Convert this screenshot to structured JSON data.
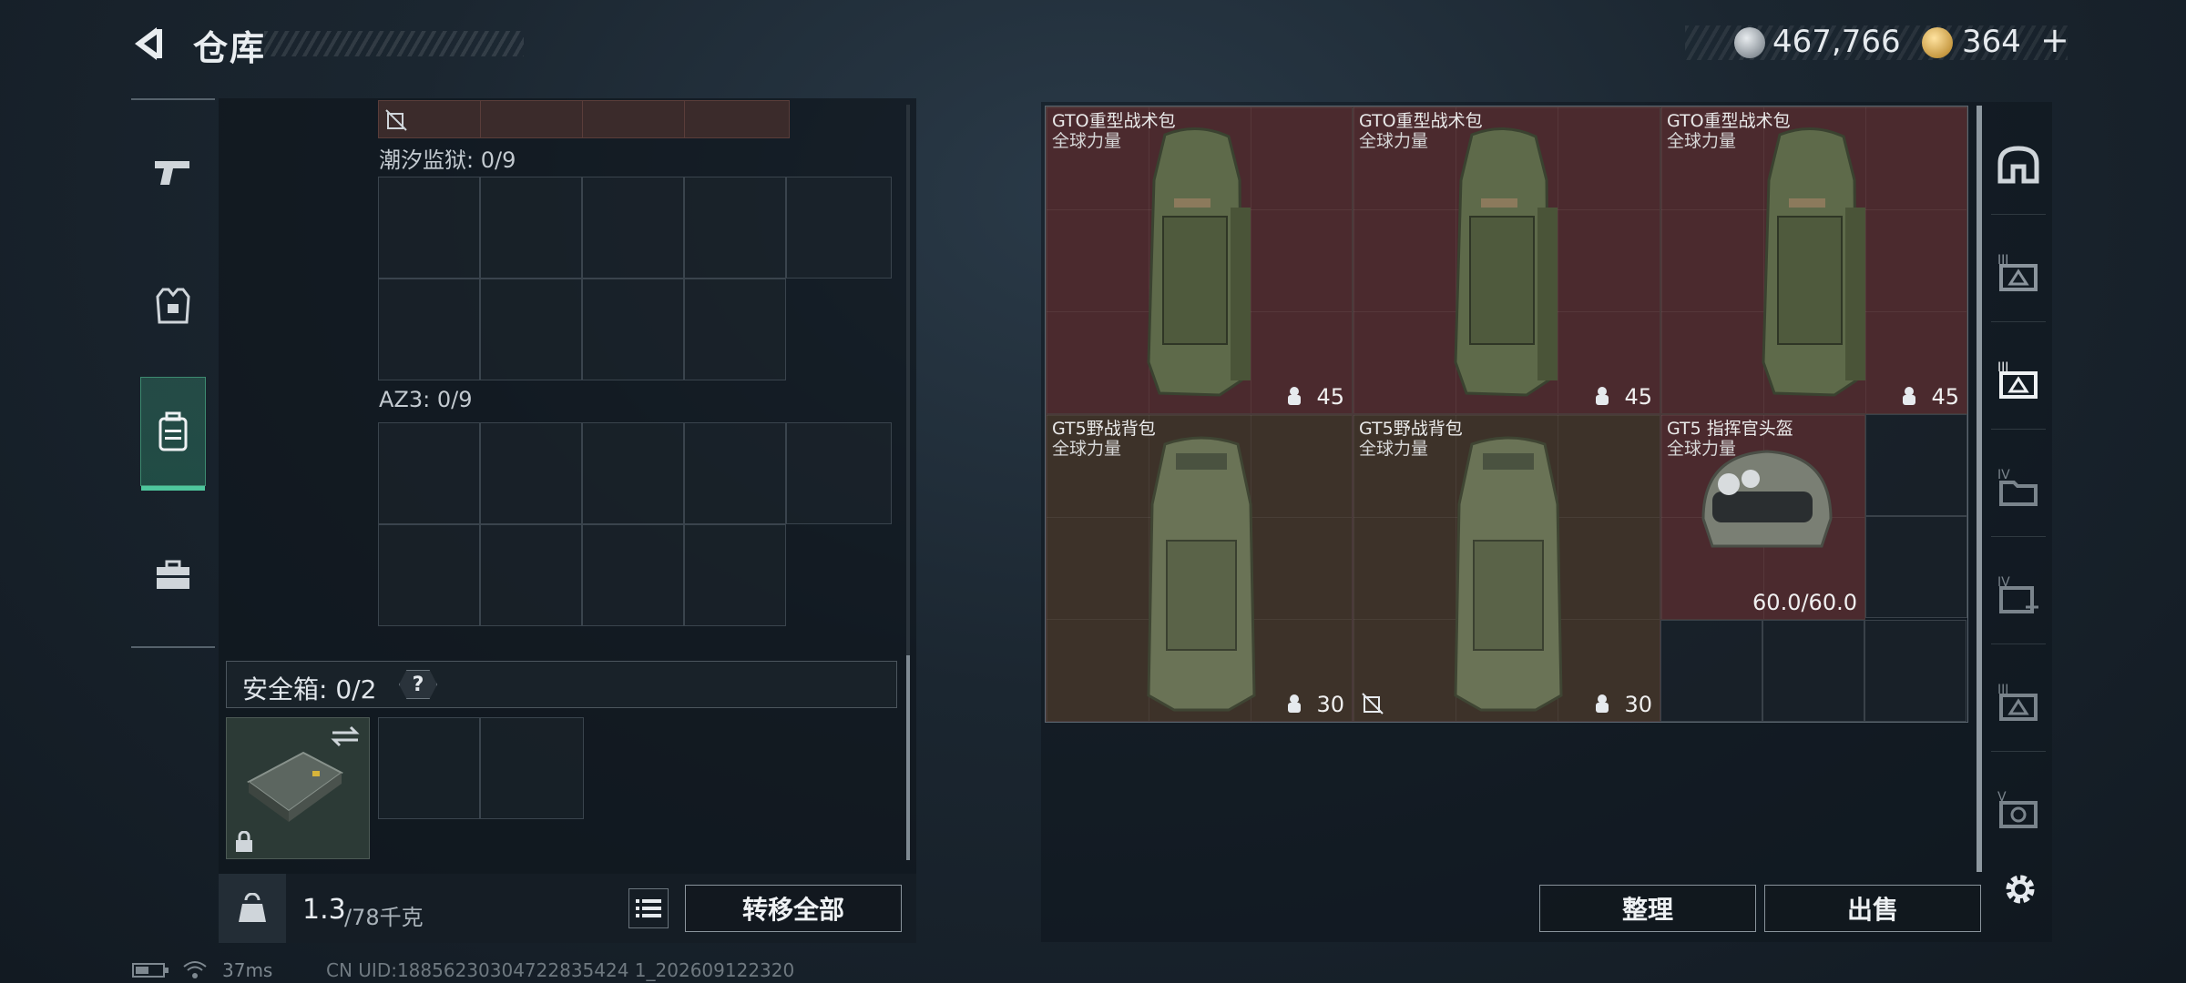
{
  "header": {
    "title": "仓库",
    "silver_amount": "467,766",
    "gold_amount": "364",
    "plus": "+"
  },
  "left_panel": {
    "container1_label": "潮汐监狱: 0/9",
    "container2_label": "AZ3: 0/9",
    "safebox_label": "安全箱: 0/2",
    "help": "?",
    "weight_current": "1.3",
    "weight_max": "/78千克",
    "transfer_all": "转移全部"
  },
  "items": [
    {
      "name": "GTO重型战术包",
      "sub": "全球力量",
      "num": "45"
    },
    {
      "name": "GTO重型战术包",
      "sub": "全球力量",
      "num": "45"
    },
    {
      "name": "GTO重型战术包",
      "sub": "全球力量",
      "num": "45"
    },
    {
      "name": "GT5野战背包",
      "sub": "全球力量",
      "num": "30"
    },
    {
      "name": "GT5野战背包",
      "sub": "全球力量",
      "num": "30"
    },
    {
      "name": "GT5 指挥官头盔",
      "sub": "全球力量",
      "num": "60.0/60.0"
    }
  ],
  "actions": {
    "sort": "整理",
    "sell": "出售"
  },
  "right_tabs": [
    "home-icon",
    "tier-3-upgrade-icon",
    "tier-3-active-icon",
    "tier-4-folder-icon",
    "tier-4-add-icon",
    "tier-3-icon",
    "tier-5-icon"
  ],
  "status": {
    "ping": "37ms",
    "uid": "CN UID:18856230304722835424 1_202609122320"
  },
  "colors": {
    "accent": "#4ec79d",
    "item_red": "#4b2a2e",
    "item_brown": "#3d3229"
  }
}
